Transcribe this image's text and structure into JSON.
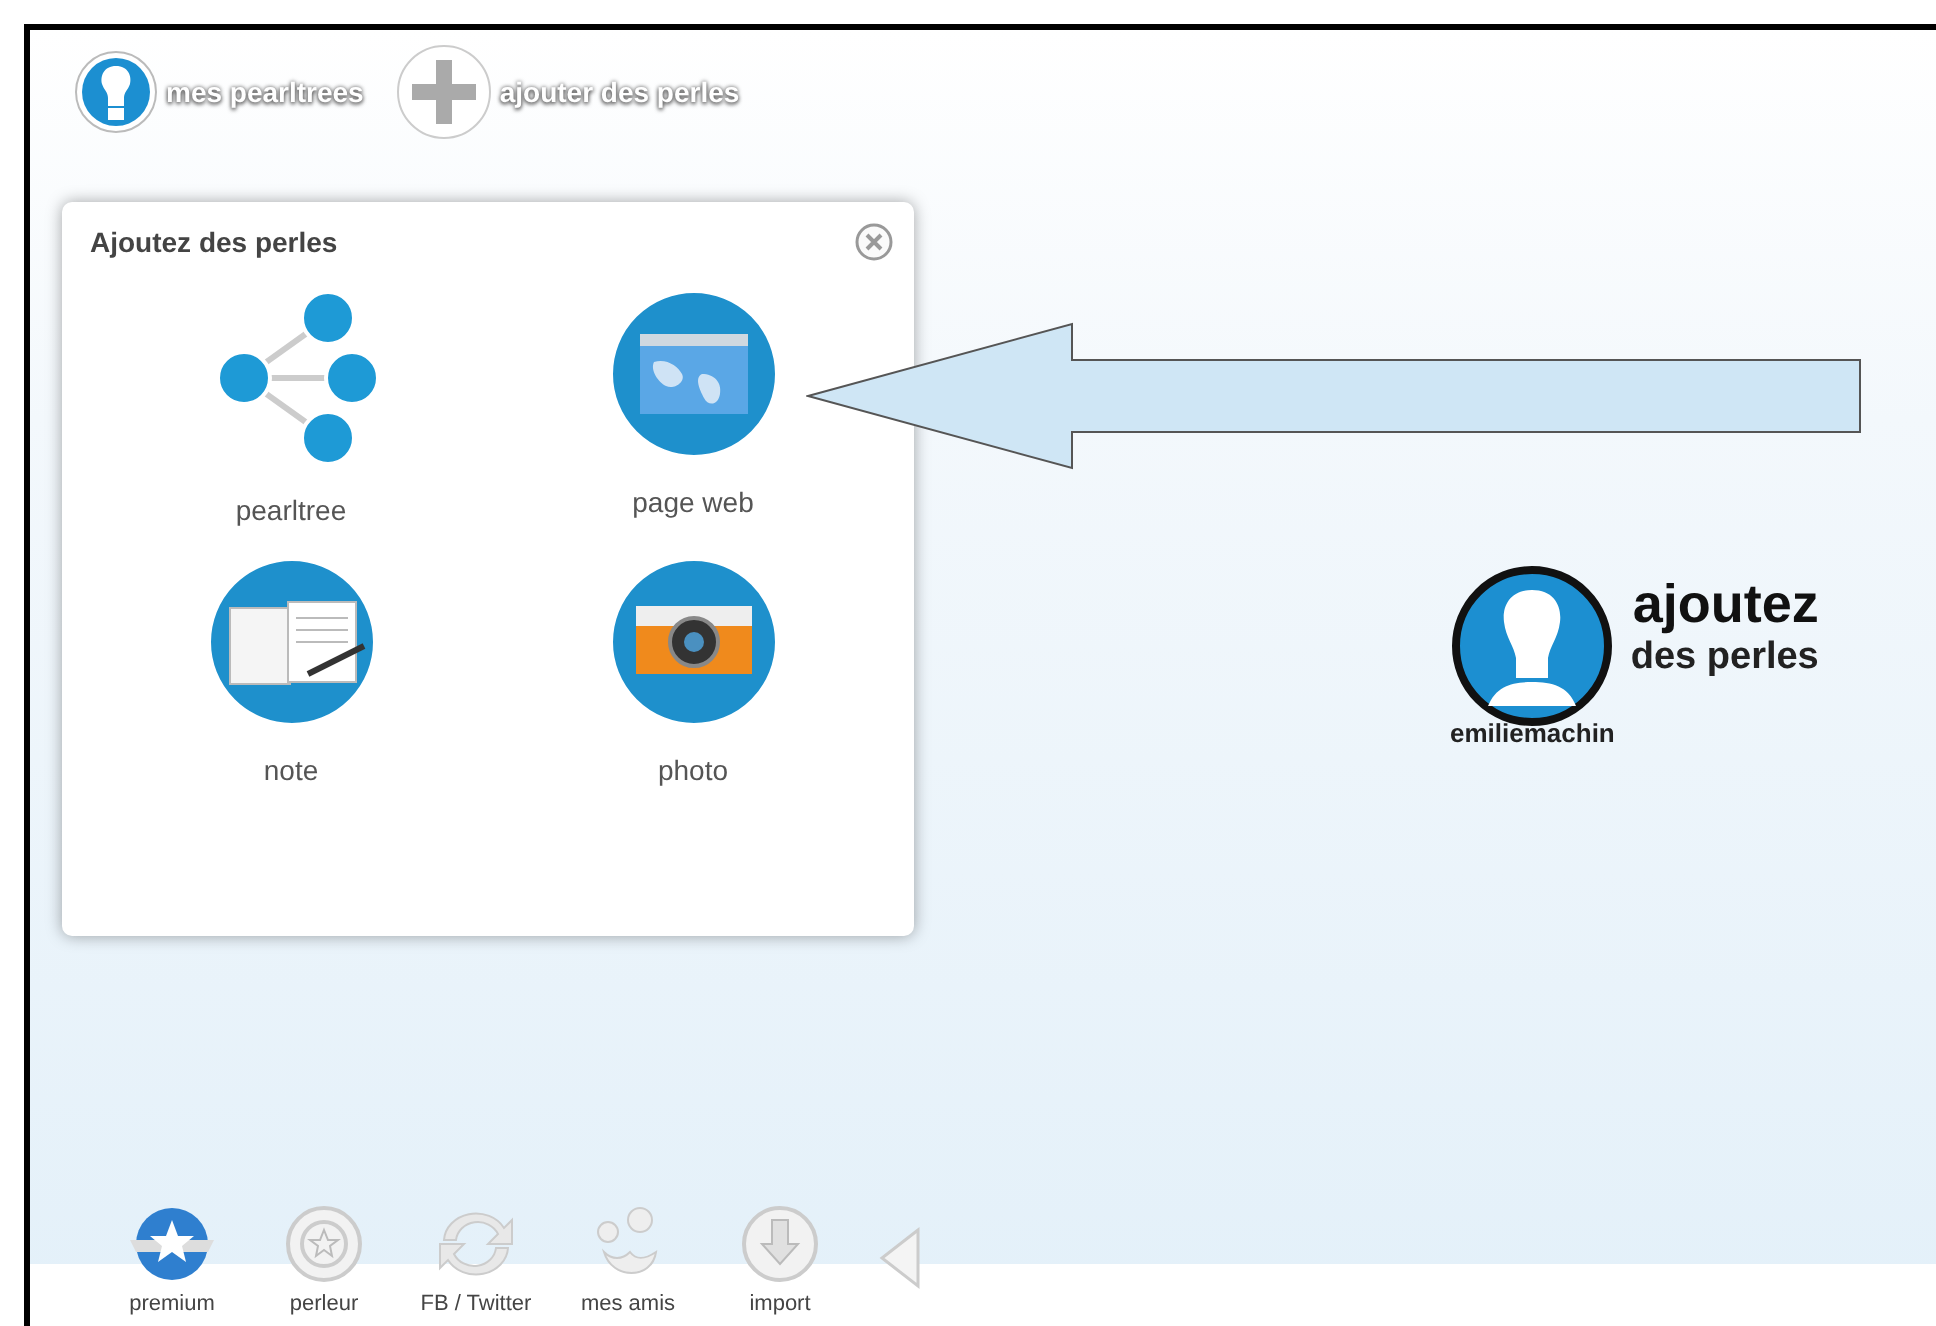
{
  "top_nav": [
    {
      "kind": "trees",
      "label": "mes pearltrees"
    },
    {
      "kind": "add",
      "label": "ajouter des perles"
    }
  ],
  "panel": {
    "title": "Ajoutez des perles",
    "options": [
      {
        "kind": "pearltree",
        "label": "pearltree"
      },
      {
        "kind": "web",
        "label": "page web"
      },
      {
        "kind": "note",
        "label": "note"
      },
      {
        "kind": "photo",
        "label": "photo"
      }
    ]
  },
  "profile": {
    "username": "emiliemachin",
    "headline": "ajoutez",
    "subline": "des perles"
  },
  "toolbar": [
    {
      "kind": "premium",
      "label": "premium"
    },
    {
      "kind": "perleur",
      "label": "perleur"
    },
    {
      "kind": "sync",
      "label": "FB / Twitter"
    },
    {
      "kind": "friends",
      "label": "mes amis"
    },
    {
      "kind": "import",
      "label": "import"
    }
  ]
}
